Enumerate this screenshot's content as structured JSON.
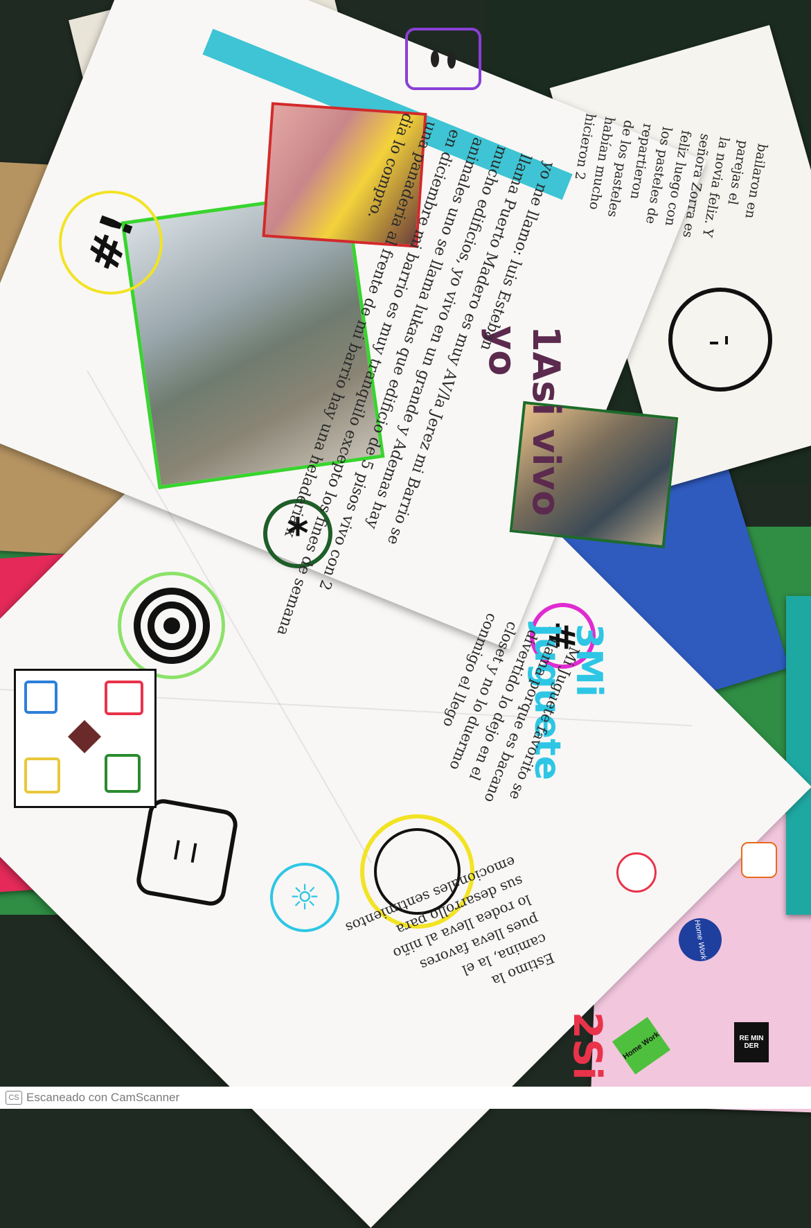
{
  "scanner": {
    "badge": "CS",
    "footer_text": "Escaneado con CamScanner"
  },
  "sections": {
    "intro": {
      "heading": "1Asi vivo yo",
      "name_line": "yo me llamo: luis Esteban",
      "text_lines": [
        "llama Puerto Madero es muy AV/la Jerez mi Barrio se",
        "mucho edificios, yo vivo en un grande y Ademas hay",
        "animales uno se llama lukas que edificio de 5 pisos vivo con 2",
        "en diciembre mi barrio es muy tranquilo excepto los fines de semana",
        "una panaderia al frente de mi barrio hay una heladeria x",
        "dia lo compro."
      ]
    },
    "story": {
      "text_lines": [
        "bailaron en",
        "parejas el",
        "la novia feliz. Y",
        "señora Zorra es",
        "feliz luego con",
        "los pasteles de",
        "repartieron",
        "de los pasteles",
        "habían mucho",
        "hicieron 2"
      ]
    },
    "toy": {
      "heading": "3Mi Juguete",
      "text_lines": [
        "Mi Juguete favorito se",
        "llama porque es bacano",
        "divertido lo dejo en el",
        "closet y no lo duermo",
        "conmigo el llego"
      ]
    },
    "trip": {
      "heading": "2Si",
      "text_lines": [
        "Estimo la",
        "camina, la el",
        "pues lleva favores",
        "lo rodea lleva al niño",
        "sus desarrollo para",
        "emocionales sentimientos"
      ]
    }
  },
  "stickers": [
    "Home Work",
    "RE MIN DER",
    "#hash"
  ],
  "icons": [
    "hashtag-icon",
    "target-icon",
    "smiley-icon",
    "asterisk-icon",
    "sun-icon",
    "square-face-icon",
    "ludo-board-icon"
  ],
  "colors": {
    "paper": "#f8f7f5",
    "teal_tape": "#3ec4d4",
    "green_frame": "#39d42f",
    "purple_text": "#5b2a4e",
    "blue_title": "#2ec6e4"
  }
}
